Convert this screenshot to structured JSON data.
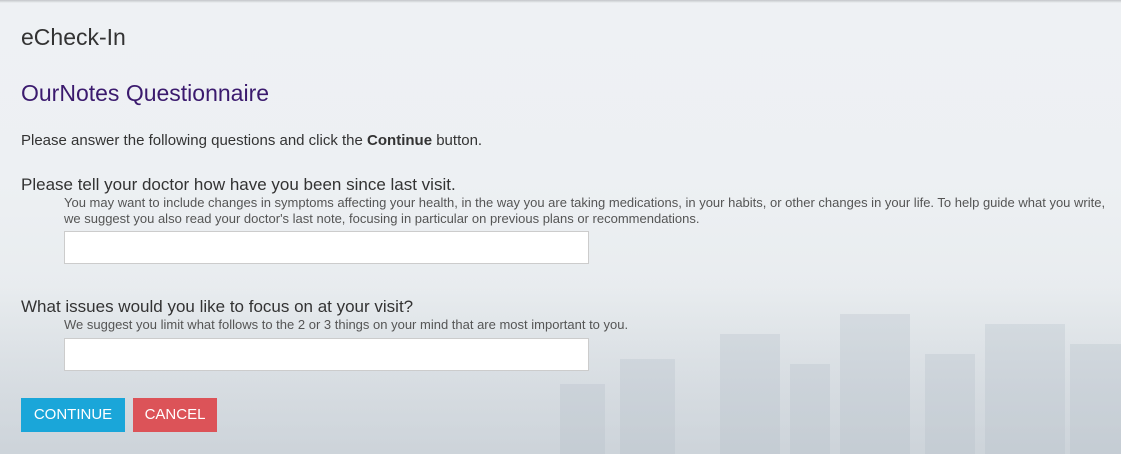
{
  "header": {
    "app_title": "eCheck-In"
  },
  "page": {
    "title": "OurNotes Questionnaire",
    "intro_before": "Please answer the following questions and click the ",
    "intro_bold": "Continue",
    "intro_after": " button."
  },
  "questions": [
    {
      "label": "Please tell your doctor how have you been since last visit.",
      "hint": "You may want to include changes in symptoms affecting your health, in the way you are taking medications, in your habits, or other changes in your life. To help guide what you write, we suggest you also read your doctor's last note, focusing in particular on previous plans or recommendations.",
      "value": "",
      "placeholder": ""
    },
    {
      "label": "What issues would you like to focus on at your visit?",
      "hint": "We suggest you limit what follows to the 2 or 3 things on your mind that are most important to you.",
      "value": "",
      "placeholder": ""
    }
  ],
  "actions": {
    "continue_label": "CONTINUE",
    "cancel_label": "CANCEL"
  },
  "colors": {
    "title_purple": "#3b1a6e",
    "continue_blue": "#1aa6d9",
    "cancel_red": "#dc5358"
  }
}
